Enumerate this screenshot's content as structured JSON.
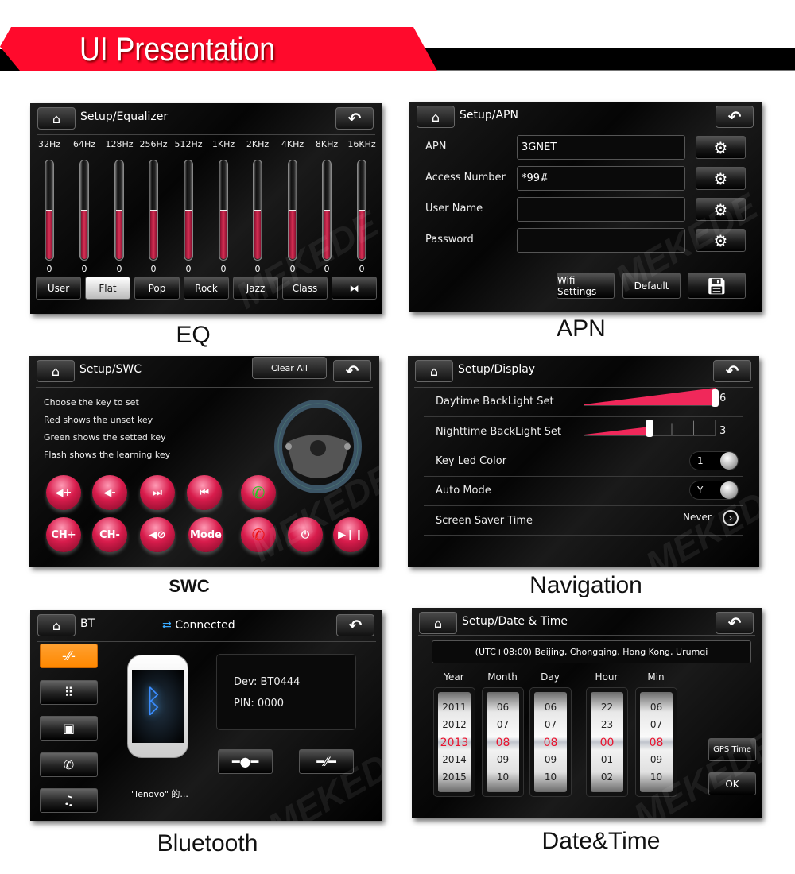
{
  "header": {
    "title": "UI Presentation",
    "accent": "#ff0a2c"
  },
  "watermark": "MEKEDE",
  "icons": {
    "home": "home-icon",
    "back": "back-arrow-icon",
    "gear": "gear-icon",
    "save": "floppy-save-icon"
  },
  "eq": {
    "title": "Setup/Equalizer",
    "caption": "EQ",
    "bands": [
      {
        "freq": "32Hz",
        "value": "0",
        "level": 0.5
      },
      {
        "freq": "64Hz",
        "value": "0",
        "level": 0.5
      },
      {
        "freq": "128Hz",
        "value": "0",
        "level": 0.5
      },
      {
        "freq": "256Hz",
        "value": "0",
        "level": 0.5
      },
      {
        "freq": "512Hz",
        "value": "0",
        "level": 0.5
      },
      {
        "freq": "1KHz",
        "value": "0",
        "level": 0.5
      },
      {
        "freq": "2KHz",
        "value": "0",
        "level": 0.5
      },
      {
        "freq": "4KHz",
        "value": "0",
        "level": 0.5
      },
      {
        "freq": "8KHz",
        "value": "0",
        "level": 0.5
      },
      {
        "freq": "16KHz",
        "value": "0",
        "level": 0.5
      }
    ],
    "presets": [
      "User",
      "Flat",
      "Pop",
      "Rock",
      "Jazz",
      "Class",
      "⧓"
    ],
    "selected_preset": "Flat"
  },
  "apn": {
    "title": "Setup/APN",
    "caption": "APN",
    "fields": [
      {
        "label": "APN",
        "value": "3GNET"
      },
      {
        "label": "Access Number",
        "value": "*99#"
      },
      {
        "label": "User Name",
        "value": ""
      },
      {
        "label": "Password",
        "value": ""
      }
    ],
    "wifi_label": "Wifi Settings",
    "default_label": "Default"
  },
  "swc": {
    "title": "Setup/SWC",
    "caption": "SWC",
    "clear_all": "Clear All",
    "instructions": [
      "Choose the key to set",
      "Red shows the unset key",
      "Green shows the setted key",
      "Flash shows the learning key"
    ],
    "keys_row1": [
      {
        "label": "◀+",
        "icon": "volume-up-icon"
      },
      {
        "label": "◀-",
        "icon": "volume-down-icon"
      },
      {
        "label": "⏭",
        "icon": "next-track-icon"
      },
      {
        "label": "⏮",
        "icon": "previous-track-icon"
      },
      {
        "label": "✆",
        "icon": "call-answer-icon",
        "color": "#22cc22"
      }
    ],
    "keys_row2": [
      {
        "label": "CH+",
        "icon": "channel-up-icon"
      },
      {
        "label": "CH-",
        "icon": "channel-down-icon"
      },
      {
        "label": "◀⊘",
        "icon": "mute-icon"
      },
      {
        "label": "Mode",
        "icon": "mode-icon"
      },
      {
        "label": "✆",
        "icon": "call-hangup-icon",
        "color": "#ee1111"
      },
      {
        "label": "⏻",
        "icon": "power-icon"
      },
      {
        "label": "▶❙❙",
        "icon": "play-pause-icon"
      }
    ]
  },
  "display": {
    "title": "Setup/Display",
    "caption": "Navigation",
    "daytime": {
      "label": "Daytime BackLight Set",
      "value": "6",
      "max": 6
    },
    "nighttime": {
      "label": "Nighttime BackLight Set",
      "value": "3",
      "max": 6
    },
    "key_led": {
      "label": "Key Led Color",
      "value": "1"
    },
    "auto_mode": {
      "label": "Auto Mode",
      "value": "Y"
    },
    "screen_saver": {
      "label": "Screen Saver Time",
      "value": "Never"
    },
    "slider_color": "#f0285a"
  },
  "bt": {
    "title": "BT",
    "status": "Connected",
    "caption": "Bluetooth",
    "device_name": "\"lenovo\" 的...",
    "dev": "Dev: BT0444",
    "pin": "PIN: 0000",
    "side": [
      {
        "icon": "link-icon",
        "glyph": "-⁄⁄-",
        "active": true
      },
      {
        "icon": "dialpad-icon",
        "glyph": "⠿"
      },
      {
        "icon": "contacts-icon",
        "glyph": "▣"
      },
      {
        "icon": "call-log-icon",
        "glyph": "✆"
      },
      {
        "icon": "music-icon",
        "glyph": "♫"
      }
    ],
    "active_color": "#ff8800"
  },
  "datetime": {
    "title": "Setup/Date & Time",
    "caption": "Date&Time",
    "timezone": "(UTC+08:00) Beijing, Chongqing, Hong Kong, Urumqi",
    "columns": [
      {
        "label": "Year",
        "items": [
          "2011",
          "2012",
          "2013",
          "2014",
          "2015"
        ]
      },
      {
        "label": "Month",
        "items": [
          "06",
          "07",
          "08",
          "09",
          "10"
        ]
      },
      {
        "label": "Day",
        "items": [
          "06",
          "07",
          "08",
          "09",
          "10"
        ]
      },
      {
        "label": "Hour",
        "items": [
          "22",
          "23",
          "00",
          "01",
          "02"
        ]
      },
      {
        "label": "Min",
        "items": [
          "06",
          "07",
          "08",
          "09",
          "10"
        ]
      }
    ],
    "gps_label": "GPS Time",
    "ok_label": "OK",
    "selected_color": "#e8132e"
  }
}
